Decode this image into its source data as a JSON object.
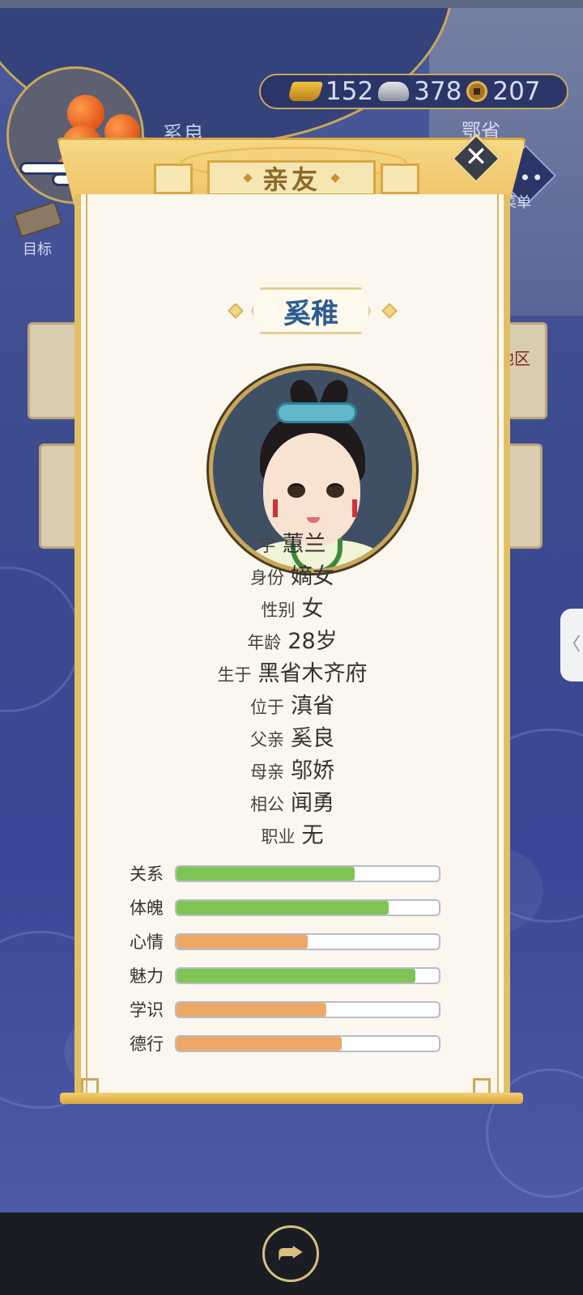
{
  "currency": {
    "gold": "152",
    "silver": "378",
    "copper": "207"
  },
  "hud": {
    "player_name_partial": "奚良",
    "location_partial": "鄂省",
    "target_label": "目标",
    "menu_label": "菜单",
    "region_partial": "地区"
  },
  "dialog": {
    "title": "亲友",
    "name": "奚稚",
    "info": [
      {
        "key": "字",
        "value": "蕙兰"
      },
      {
        "key": "身份",
        "value": "嫡女"
      },
      {
        "key": "性别",
        "value": "女"
      },
      {
        "key": "年龄",
        "value": "28岁"
      },
      {
        "key": "生于",
        "value": "黑省木齐府"
      },
      {
        "key": "位于",
        "value": "滇省"
      },
      {
        "key": "父亲",
        "value": "奚良"
      },
      {
        "key": "母亲",
        "value": "邬娇"
      },
      {
        "key": "相公",
        "value": "闻勇"
      },
      {
        "key": "职业",
        "value": "无"
      }
    ],
    "stats": [
      {
        "label": "关系",
        "value": 0.68,
        "color": "#7fc556"
      },
      {
        "label": "体魄",
        "value": 0.81,
        "color": "#7fc556"
      },
      {
        "label": "心情",
        "value": 0.5,
        "color": "#eea866"
      },
      {
        "label": "魅力",
        "value": 0.91,
        "color": "#7fc556"
      },
      {
        "label": "学识",
        "value": 0.57,
        "color": "#eea866"
      },
      {
        "label": "德行",
        "value": 0.63,
        "color": "#eea866"
      }
    ]
  },
  "icons": {
    "close": "✕",
    "share": "⮫",
    "side_tab": "〈",
    "menu_dots": "•••"
  }
}
